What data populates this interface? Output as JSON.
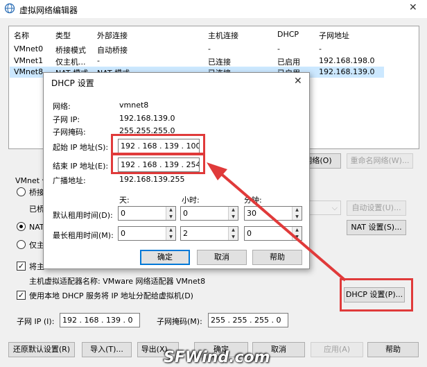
{
  "main_window": {
    "title": "虚拟网络编辑器",
    "columns": [
      "名称",
      "类型",
      "外部连接",
      "主机连接",
      "DHCP",
      "子网地址"
    ],
    "rows": [
      [
        "VMnet0",
        "桥接模式",
        "自动桥接",
        "-",
        "-",
        "-"
      ],
      [
        "VMnet1",
        "仅主机...",
        "-",
        "已连接",
        "已启用",
        "192.168.198.0"
      ],
      [
        "VMnet8",
        "NAT 模式",
        "NAT 模式",
        "已连接",
        "已启用",
        "192.168.139.0"
      ]
    ],
    "btn_remove_network": "移除网络(O)",
    "btn_rename_network": "重命名网络(W)...",
    "vmnet_info_label": "VMnet 信息",
    "radio_bridge": "桥接模式(将虚拟机直接连接到外部网络)(B)",
    "bridged_to_label": "已桥接至(G):",
    "btn_auto_settings": "自动设置(U)...",
    "radio_nat": "NAT 模式(与虚拟机共享主机的 IP 地址)(N)",
    "btn_nat_settings": "NAT 设置(S)...",
    "radio_host_only": "仅主机模式(在专用网络内连接虚拟机)(H)",
    "check_connect_host": "将主机虚拟适配器连接到此网络(V)",
    "adapter_name": "主机虚拟适配器名称: VMware 网络适配器 VMnet8",
    "check_use_dhcp": "使用本地 DHCP 服务将 IP 地址分配给虚拟机(D)",
    "btn_dhcp_settings": "DHCP 设置(P)...",
    "subnet_ip_label": "子网 IP (I):",
    "subnet_ip_value": "192 . 168 . 139 .  0",
    "subnet_mask_label": "子网掩码(M):",
    "subnet_mask_value": "255 . 255 . 255 .  0",
    "btn_restore_defaults": "还原默认设置(R)",
    "btn_import": "导入(T)...",
    "btn_export": "导出(X)...",
    "btn_ok": "确定",
    "btn_cancel": "取消",
    "btn_apply": "应用(A)",
    "btn_help": "帮助"
  },
  "dhcp_dialog": {
    "title": "DHCP 设置",
    "close_glyph": "✕",
    "network_label": "网络:",
    "network_value": "vmnet8",
    "subnet_ip_label": "子网 IP:",
    "subnet_ip_value": "192.168.139.0",
    "subnet_mask_label": "子网掩码:",
    "subnet_mask_value": "255.255.255.0",
    "start_ip_label": "起始 IP 地址(S):",
    "start_ip_value": "192 . 168 . 139 . 100",
    "end_ip_label": "结束 IP 地址(E):",
    "end_ip_value": "192 . 168 . 139 . 254",
    "broadcast_label": "广播地址:",
    "broadcast_value": "192.168.139.255",
    "col_days": "天:",
    "col_hours": "小时:",
    "col_minutes": "分钟:",
    "default_lease_label": "默认租用时间(D):",
    "default_lease": [
      "0",
      "0",
      "30"
    ],
    "max_lease_label": "最长租用时间(M):",
    "max_lease": [
      "0",
      "2",
      "0"
    ],
    "btn_ok": "确定",
    "btn_cancel": "取消",
    "btn_help": "帮助"
  },
  "watermark": "SFWind.com",
  "colors": {
    "highlight": "#e03a3a",
    "selection": "#cce8ff",
    "accent": "#0078d7"
  }
}
